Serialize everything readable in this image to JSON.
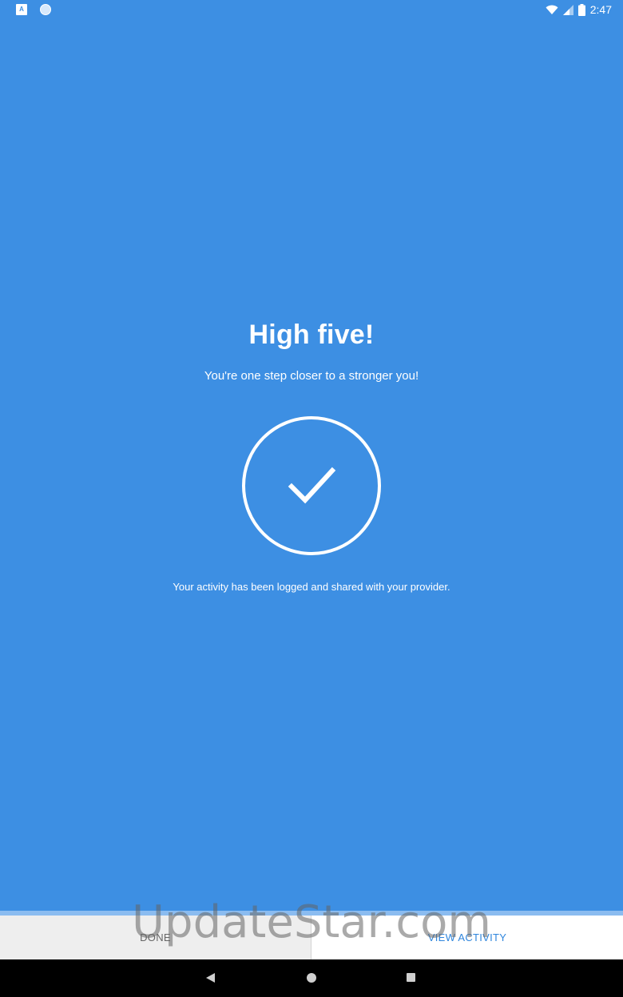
{
  "status_bar": {
    "time": "2:47",
    "notification_icons": [
      "app-a-icon",
      "sync-dot-icon"
    ],
    "system_icons": [
      "wifi-icon",
      "signal-icon",
      "battery-icon"
    ]
  },
  "main": {
    "title": "High five!",
    "subtitle": "You're one step closer to a stronger you!",
    "icon": "checkmark-circle-icon",
    "message": "Your activity has been logged and shared with your provider."
  },
  "buttons": {
    "done_label": "DONE",
    "view_activity_label": "VIEW ACTIVITY"
  },
  "watermark": {
    "text": "UpdateStar.com"
  },
  "nav_bar": {
    "icons": [
      "back-icon",
      "home-icon",
      "recents-icon"
    ]
  },
  "colors": {
    "background": "#3d8fe3",
    "accent": "#2f86dd",
    "done_button_bg": "#eeeeee",
    "view_button_bg": "#ffffff"
  }
}
